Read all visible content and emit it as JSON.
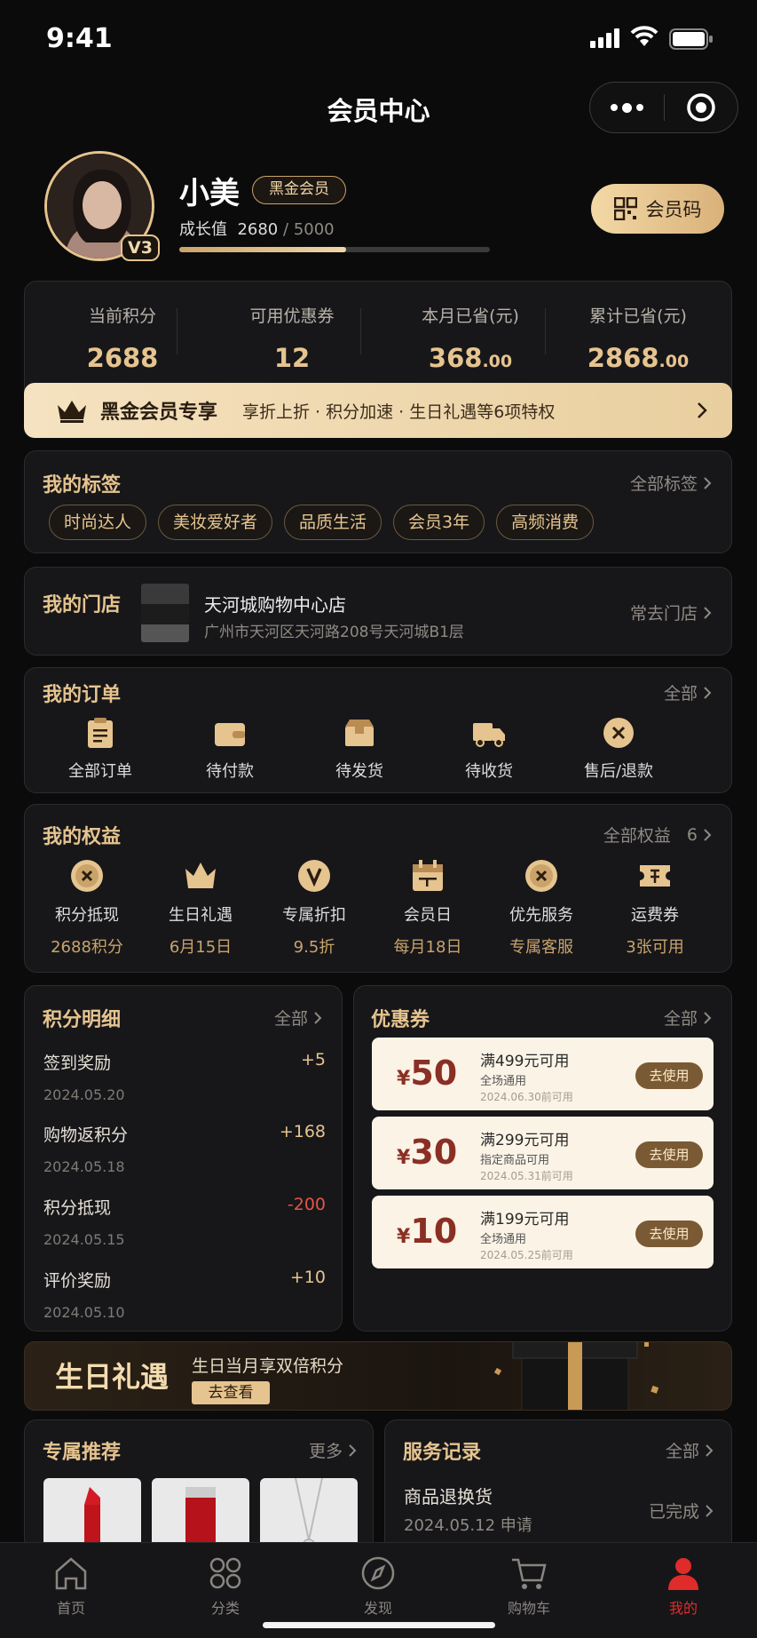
{
  "status_bar": {
    "time": "9:41"
  },
  "header": {
    "title": "会员中心"
  },
  "profile": {
    "name": "小美",
    "tier": "黑金会员",
    "level": "V3",
    "growth_label": "成长值",
    "growth_value": "2680",
    "growth_sep": "/",
    "growth_max": "5000",
    "growth_progress": 0.536,
    "member_code_label": "会员码"
  },
  "stats": [
    {
      "label": "当前积分",
      "value": "2688",
      "decimal": ""
    },
    {
      "label": "可用优惠券",
      "value": "12",
      "decimal": ""
    },
    {
      "label": "本月已省(元)",
      "value": "368",
      "decimal": ".00"
    },
    {
      "label": "累计已省(元)",
      "value": "2868",
      "decimal": ".00"
    }
  ],
  "vip_strip": {
    "title": "黑金会员专享",
    "desc": "享折上折 · 积分加速 · 生日礼遇等6项特权"
  },
  "tags": {
    "title": "我的标签",
    "more": "全部标签",
    "items": [
      "时尚达人",
      "美妆爱好者",
      "品质生活",
      "会员3年",
      "高频消费"
    ]
  },
  "store": {
    "title": "我的门店",
    "name": "天河城购物中心店",
    "address": "广州市天河区天河路208号天河城B1层",
    "more": "常去门店"
  },
  "orders": {
    "title": "我的订单",
    "more": "全部",
    "items": [
      {
        "label": "全部订单",
        "icon": "clipboard-icon"
      },
      {
        "label": "待付款",
        "icon": "wallet-icon"
      },
      {
        "label": "待发货",
        "icon": "box-icon"
      },
      {
        "label": "待收货",
        "icon": "truck-icon"
      },
      {
        "label": "售后/退款",
        "icon": "refund-icon"
      }
    ]
  },
  "rights": {
    "title": "我的权益",
    "more": "全部权益",
    "count": "6",
    "items": [
      {
        "label": "积分抵现",
        "sub": "2688积分",
        "icon": "coin-icon"
      },
      {
        "label": "生日礼遇",
        "sub": "6月15日",
        "icon": "crown-icon"
      },
      {
        "label": "专属折扣",
        "sub": "9.5折",
        "icon": "vip-badge-icon"
      },
      {
        "label": "会员日",
        "sub": "每月18日",
        "icon": "calendar-icon"
      },
      {
        "label": "优先服务",
        "sub": "专属客服",
        "icon": "service-icon"
      },
      {
        "label": "运费券",
        "sub": "3张可用",
        "icon": "ticket-icon"
      }
    ]
  },
  "points": {
    "title": "积分明细",
    "more": "全部",
    "rows": [
      {
        "name": "签到奖励",
        "date": "2024.05.20",
        "value": "+5",
        "negative": false
      },
      {
        "name": "购物返积分",
        "date": "2024.05.18",
        "value": "+168",
        "negative": false
      },
      {
        "name": "积分抵现",
        "date": "2024.05.15",
        "value": "-200",
        "negative": true
      },
      {
        "name": "评价奖励",
        "date": "2024.05.10",
        "value": "+10",
        "negative": false
      }
    ]
  },
  "coupons": {
    "title": "优惠券",
    "more": "全部",
    "items": [
      {
        "currency": "¥",
        "amount": "50",
        "condition": "满499元可用",
        "scope": "全场通用",
        "expire": "2024.06.30前可用",
        "action": "去使用"
      },
      {
        "currency": "¥",
        "amount": "30",
        "condition": "满299元可用",
        "scope": "指定商品可用",
        "expire": "2024.05.31前可用",
        "action": "去使用"
      },
      {
        "currency": "¥",
        "amount": "10",
        "condition": "满199元可用",
        "scope": "全场通用",
        "expire": "2024.05.25前可用",
        "action": "去使用"
      }
    ]
  },
  "birthday": {
    "title": "生日礼遇",
    "desc": "生日当月享双倍积分",
    "button": "去查看"
  },
  "recommend": {
    "title": "专属推荐",
    "more": "更多"
  },
  "service": {
    "title": "服务记录",
    "more": "全部",
    "item_title": "商品退换货",
    "item_date": "2024.05.12",
    "item_action": "申请",
    "item_status": "已完成"
  },
  "tabbar": [
    {
      "label": "首页",
      "icon": "home-icon",
      "active": false
    },
    {
      "label": "分类",
      "icon": "category-icon",
      "active": false
    },
    {
      "label": "发现",
      "icon": "compass-icon",
      "active": false
    },
    {
      "label": "购物车",
      "icon": "cart-icon",
      "active": false
    },
    {
      "label": "我的",
      "icon": "user-icon",
      "active": true
    }
  ],
  "colors": {
    "accent_gold": "#e6c48f",
    "background": "#0b0b0b",
    "card": "#17171a",
    "negative": "#e25646",
    "tab_active": "#e02b2b"
  }
}
